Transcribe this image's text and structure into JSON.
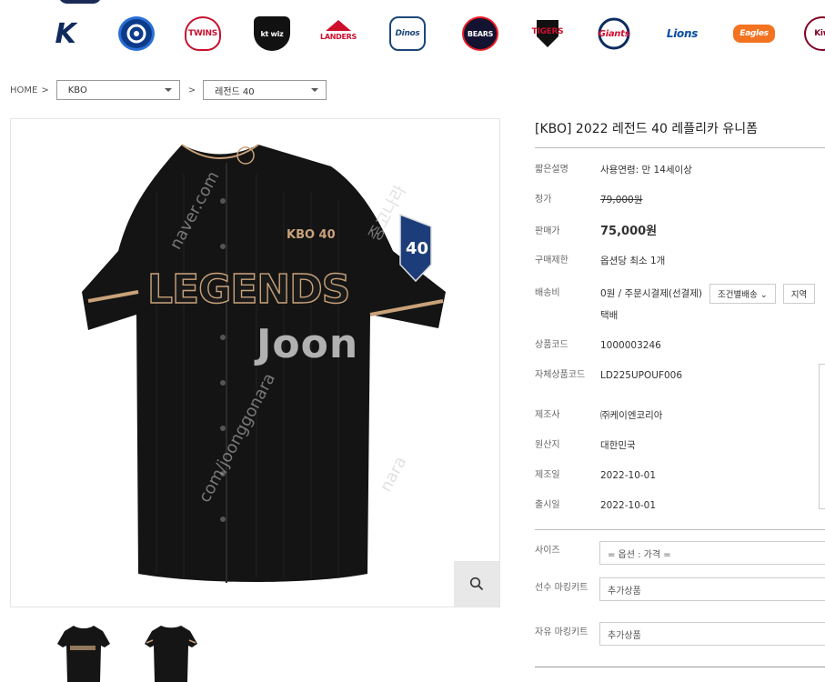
{
  "teams": [
    {
      "name": "K",
      "icon": "kbo-k-logo"
    },
    {
      "name": "",
      "icon": "kbo-circle-logo"
    },
    {
      "name": "TWINS",
      "icon": "lg-twins-logo"
    },
    {
      "name": "kt wiz",
      "icon": "kt-wiz-logo"
    },
    {
      "name": "LANDERS",
      "icon": "ssg-landers-logo"
    },
    {
      "name": "Dinos",
      "icon": "nc-dinos-logo"
    },
    {
      "name": "BEARS",
      "icon": "doosan-bears-logo"
    },
    {
      "name": "TIGERS",
      "icon": "kia-tigers-logo"
    },
    {
      "name": "Giants",
      "icon": "lotte-giants-logo"
    },
    {
      "name": "Lions",
      "icon": "samsung-lions-logo"
    },
    {
      "name": "Eagles",
      "icon": "hanwha-eagles-logo"
    },
    {
      "name": "Kiw",
      "icon": "kiwoom-heroes-logo"
    }
  ],
  "breadcrumb": {
    "home": "HOME",
    "sep": ">",
    "category": "KBO",
    "subcategory": "레전드 40"
  },
  "product": {
    "title": "[KBO] 2022 레전드 40 레플리카 유니폼",
    "jersey_text": "LEGENDS",
    "jersey_logo": "KBO 40",
    "watermark": "Joon",
    "fields": {
      "summary_label": "짧은설명",
      "summary": "사용연령: 만 14세이상",
      "list_price_label": "정가",
      "list_price": "79,000원",
      "price_label": "판매가",
      "price": "75,000원",
      "limit_label": "구매제한",
      "limit": "옵션당 최소 1개",
      "shipping_label": "배송비",
      "shipping": "0원  / 주문시결제(선결제)",
      "shipping_method": "택배",
      "shipping_btn1": "조건별배송 ⌄",
      "shipping_btn2": "지역",
      "code_label": "상품코드",
      "code": "1000003246",
      "own_code_label": "자체상품코드",
      "own_code": "LD225UPOUF006",
      "maker_label": "제조사",
      "maker": "㈜케이엔코리아",
      "origin_label": "원산지",
      "origin": "대한민국",
      "made_date_label": "제조일",
      "made_date": "2022-10-01",
      "release_label": "출시일",
      "release": "2022-10-01"
    },
    "options": {
      "size_label": "사이즈",
      "size_value": "= 옵션 : 가격 =",
      "player_label": "선수 마킹키트",
      "player_value": "추가상품",
      "free_label": "자유 마킹키트",
      "free_value": "추가상품"
    }
  },
  "colors": {
    "jersey": "#141414",
    "trim": "#c9a27a"
  }
}
